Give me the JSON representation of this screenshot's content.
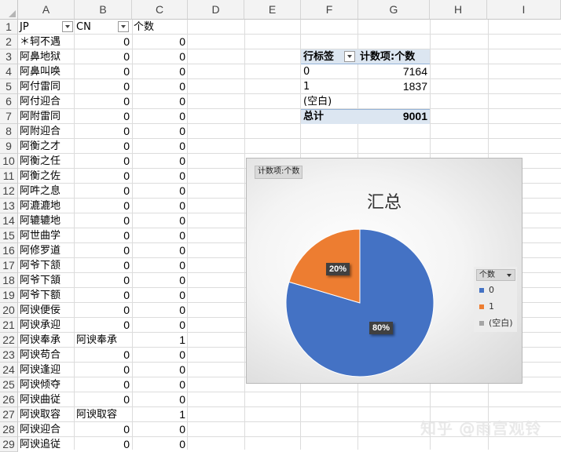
{
  "columns": [
    "A",
    "B",
    "C",
    "D",
    "E",
    "F",
    "G",
    "H",
    "I"
  ],
  "rows": [
    "1",
    "2",
    "3",
    "4",
    "5",
    "6",
    "7",
    "8",
    "9",
    "10",
    "11",
    "12",
    "13",
    "14",
    "15",
    "16",
    "17",
    "18",
    "19",
    "20",
    "21",
    "22",
    "23",
    "24",
    "25",
    "26",
    "27",
    "28",
    "29"
  ],
  "header_row": {
    "jp": "JP",
    "cn": "CN",
    "count": "个数"
  },
  "data_rows": [
    {
      "jp": "＊轲不遇",
      "cn": "0",
      "count": "0"
    },
    {
      "jp": "阿鼻地狱",
      "cn": "0",
      "count": "0"
    },
    {
      "jp": "阿鼻叫唤",
      "cn": "0",
      "count": "0"
    },
    {
      "jp": "阿付雷同",
      "cn": "0",
      "count": "0"
    },
    {
      "jp": "阿付迎合",
      "cn": "0",
      "count": "0"
    },
    {
      "jp": "阿附雷同",
      "cn": "0",
      "count": "0"
    },
    {
      "jp": "阿附迎合",
      "cn": "0",
      "count": "0"
    },
    {
      "jp": "阿衡之才",
      "cn": "0",
      "count": "0"
    },
    {
      "jp": "阿衡之任",
      "cn": "0",
      "count": "0"
    },
    {
      "jp": "阿衡之佐",
      "cn": "0",
      "count": "0"
    },
    {
      "jp": "阿吽之息",
      "cn": "0",
      "count": "0"
    },
    {
      "jp": "阿漉漉地",
      "cn": "0",
      "count": "0"
    },
    {
      "jp": "阿辘辘地",
      "cn": "0",
      "count": "0"
    },
    {
      "jp": "阿世曲学",
      "cn": "0",
      "count": "0"
    },
    {
      "jp": "阿修罗道",
      "cn": "0",
      "count": "0"
    },
    {
      "jp": "阿爷下颔",
      "cn": "0",
      "count": "0"
    },
    {
      "jp": "阿爷下頷",
      "cn": "0",
      "count": "0"
    },
    {
      "jp": "阿爷下额",
      "cn": "0",
      "count": "0"
    },
    {
      "jp": "阿谀便佞",
      "cn": "0",
      "count": "0"
    },
    {
      "jp": "阿谀承迎",
      "cn": "0",
      "count": "0"
    },
    {
      "jp": "阿谀奉承",
      "cn": "阿谀奉承",
      "count": "1"
    },
    {
      "jp": "阿谀苟合",
      "cn": "0",
      "count": "0"
    },
    {
      "jp": "阿谀逢迎",
      "cn": "0",
      "count": "0"
    },
    {
      "jp": "阿谀倾夺",
      "cn": "0",
      "count": "0"
    },
    {
      "jp": "阿谀曲従",
      "cn": "0",
      "count": "0"
    },
    {
      "jp": "阿谀取容",
      "cn": "阿谀取容",
      "count": "1"
    },
    {
      "jp": "阿谀迎合",
      "cn": "0",
      "count": "0"
    },
    {
      "jp": "阿谀追従",
      "cn": "0",
      "count": "0"
    }
  ],
  "pivot": {
    "row_label": "行标签",
    "value_label": "计数项:个数",
    "rows": [
      {
        "label": "0",
        "value": "7164"
      },
      {
        "label": "1",
        "value": "1837"
      },
      {
        "label": "(空白)",
        "value": ""
      }
    ],
    "total_label": "总计",
    "total_value": "9001"
  },
  "chart": {
    "field_button": "计数项:个数",
    "title": "汇总",
    "legend_title": "个数",
    "slice_labels": [
      "80%",
      "20%"
    ]
  },
  "chart_data": {
    "type": "pie",
    "title": "汇总",
    "categories": [
      "0",
      "1",
      "(空白)"
    ],
    "values": [
      7164,
      1837,
      0
    ],
    "colors": [
      "#4472c4",
      "#ed7d31",
      "#a5a5a5"
    ],
    "legend": "right"
  },
  "watermark": "知乎 @雨宫观铃"
}
